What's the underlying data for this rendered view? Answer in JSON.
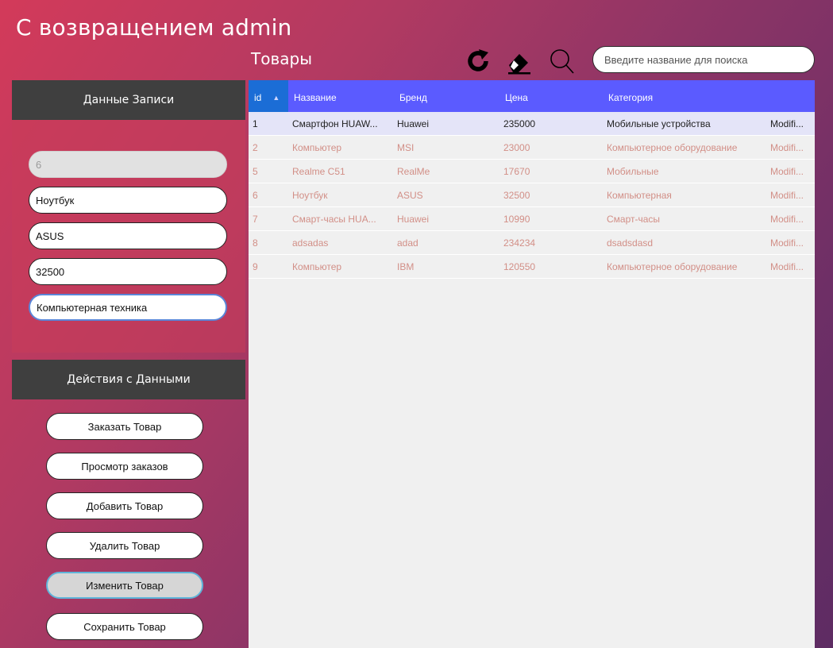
{
  "header": {
    "welcome": "С возвращением admin",
    "products_title": "Товары",
    "search_placeholder": "Введите название для поиска"
  },
  "toolbar": {
    "icons": [
      "refresh-icon",
      "eraser-icon",
      "search-icon"
    ]
  },
  "record_panel": {
    "title": "Данные Записи",
    "id_value": "6",
    "name_value": "Ноутбук",
    "brand_value": "ASUS",
    "price_value": "32500",
    "category_value": "Компьютерная техника"
  },
  "actions_panel": {
    "title": "Действия с Данными",
    "buttons": [
      "Заказать Товар",
      "Просмотр заказов",
      "Добавить Товар",
      "Удалить Товар",
      "Изменить Товар",
      "Сохранить Товар"
    ]
  },
  "table": {
    "columns": [
      "id",
      "Название",
      "Бренд",
      "Цена",
      "Категория"
    ],
    "rows": [
      {
        "id": "1",
        "name": "Смартфон HUAW...",
        "brand": "Huawei",
        "price": "235000",
        "category": "Мобильные устройства",
        "mod": "Modifi..."
      },
      {
        "id": "2",
        "name": "Компьютер",
        "brand": "MSI",
        "price": "23000",
        "category": "Компьютерное оборудование",
        "mod": "Modifi..."
      },
      {
        "id": "5",
        "name": "Realme C51",
        "brand": "RealMe",
        "price": "17670",
        "category": "Мобильные",
        "mod": "Modifi..."
      },
      {
        "id": "6",
        "name": "Ноутбук",
        "brand": "ASUS",
        "price": "32500",
        "category": "Компьютерная",
        "mod": "Modifi..."
      },
      {
        "id": "7",
        "name": "Смарт-часы HUA...",
        "brand": "Huawei",
        "price": "10990",
        "category": "Смарт-часы",
        "mod": "Modifi..."
      },
      {
        "id": "8",
        "name": "adsadas",
        "brand": "adad",
        "price": "234234",
        "category": "dsadsdasd",
        "mod": "Modifi..."
      },
      {
        "id": "9",
        "name": "Компьютер",
        "brand": "IBM",
        "price": "120550",
        "category": "Компьютерное оборудование",
        "mod": "Modifi..."
      }
    ]
  },
  "colors": {
    "table_header": "#5b5bff",
    "id_header": "#1b6dd6",
    "selected_row": "#e4e4f8",
    "row_text": "#d28f87",
    "panel_header": "#3f3f3f"
  }
}
